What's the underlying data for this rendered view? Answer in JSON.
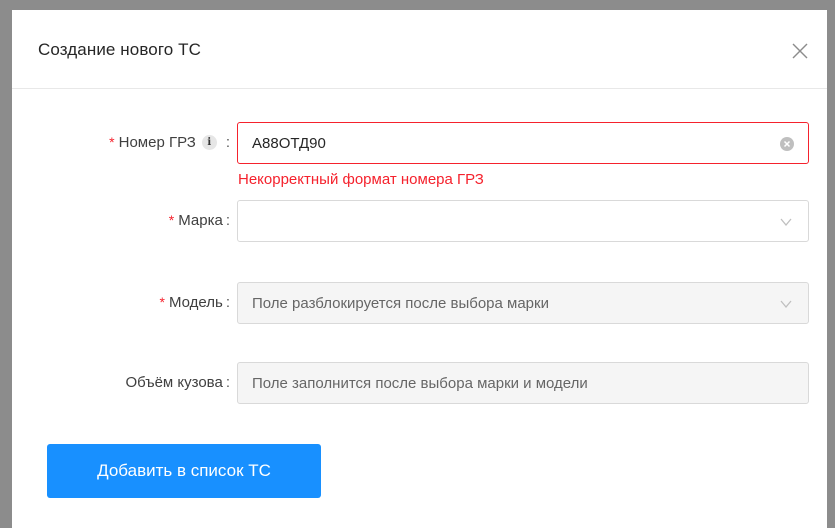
{
  "modal": {
    "title": "Создание нового ТС"
  },
  "form": {
    "plate": {
      "required_mark": "*",
      "label": "Номер ГРЗ",
      "info_icon_text": "i",
      "colon": ":",
      "value": "А88ОТД90",
      "error": "Некорректный формат номера ГРЗ"
    },
    "brand": {
      "required_mark": "*",
      "label": "Марка",
      "colon": ":",
      "value": ""
    },
    "model": {
      "required_mark": "*",
      "label": "Модель",
      "colon": ":",
      "placeholder": "Поле разблокируется после выбора марки"
    },
    "volume": {
      "label": "Объём кузова",
      "colon": ":",
      "placeholder": "Поле заполнится после выбора марки и модели"
    }
  },
  "actions": {
    "submit_label": "Добавить в список ТС"
  },
  "colors": {
    "primary": "#1890ff",
    "error": "#f5222d"
  }
}
